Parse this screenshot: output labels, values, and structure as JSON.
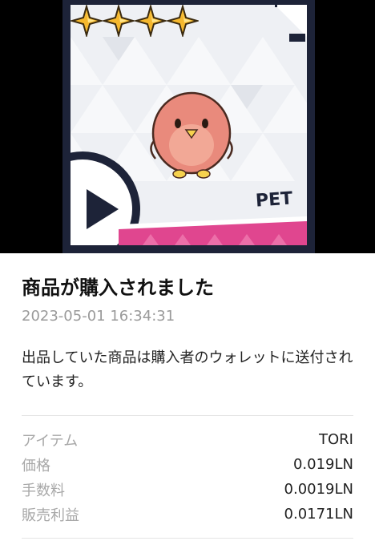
{
  "hero": {
    "rarity_stars": 4,
    "category_label": "PET",
    "icons": [
      "star-icon",
      "play-icon",
      "bird-icon"
    ],
    "colors": {
      "frame": "#1d2338",
      "pink": "#e0468f",
      "star": "#f5b82e",
      "bird": "#e98a7c"
    }
  },
  "notification": {
    "title": "商品が購入されました",
    "timestamp": "2023-05-01 16:34:31",
    "message": "出品していた商品は購入者のウォレットに送付されています。"
  },
  "details": [
    {
      "label": "アイテム",
      "value": "TORI"
    },
    {
      "label": "価格",
      "value": "0.019LN"
    },
    {
      "label": "手数料",
      "value": "0.0019LN"
    },
    {
      "label": "販売利益",
      "value": "0.0171LN"
    }
  ]
}
